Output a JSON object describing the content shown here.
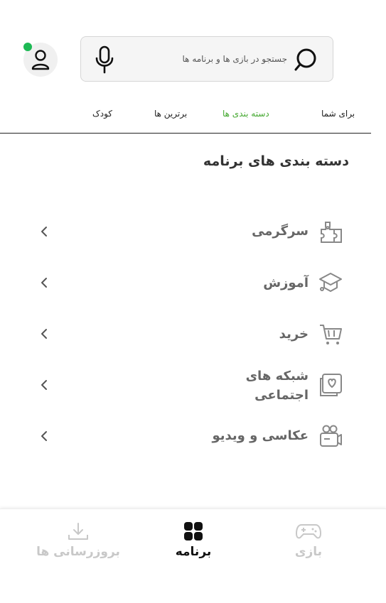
{
  "header": {
    "search_placeholder": "جستجو در بازی ها و برنامه ها",
    "online_color": "#1db954"
  },
  "tabs": [
    {
      "label": "برای شما",
      "active": false
    },
    {
      "label": "دسته بندی ها",
      "active": true
    },
    {
      "label": "برترین ها",
      "active": false
    },
    {
      "label": "کودک",
      "active": false
    }
  ],
  "accent_color": "#43a82f",
  "section": {
    "title": "دسته بندی های برنامه"
  },
  "categories": [
    {
      "label": "سرگرمی",
      "icon": "puzzle-icon"
    },
    {
      "label": "آموزش",
      "icon": "graduation-cap-icon"
    },
    {
      "label": "خرید",
      "icon": "shopping-cart-icon"
    },
    {
      "label": "شبکه های اجتماعی",
      "icon": "social-profile-icon"
    },
    {
      "label": "عکاسی و ویدیو",
      "icon": "video-camera-icon"
    }
  ],
  "bottom_nav": [
    {
      "label": "بازی",
      "icon": "gamepad-icon",
      "active": false
    },
    {
      "label": "برنامه",
      "icon": "apps-grid-icon",
      "active": true
    },
    {
      "label": "بروزرسانی ها",
      "icon": "download-icon",
      "active": false
    }
  ]
}
